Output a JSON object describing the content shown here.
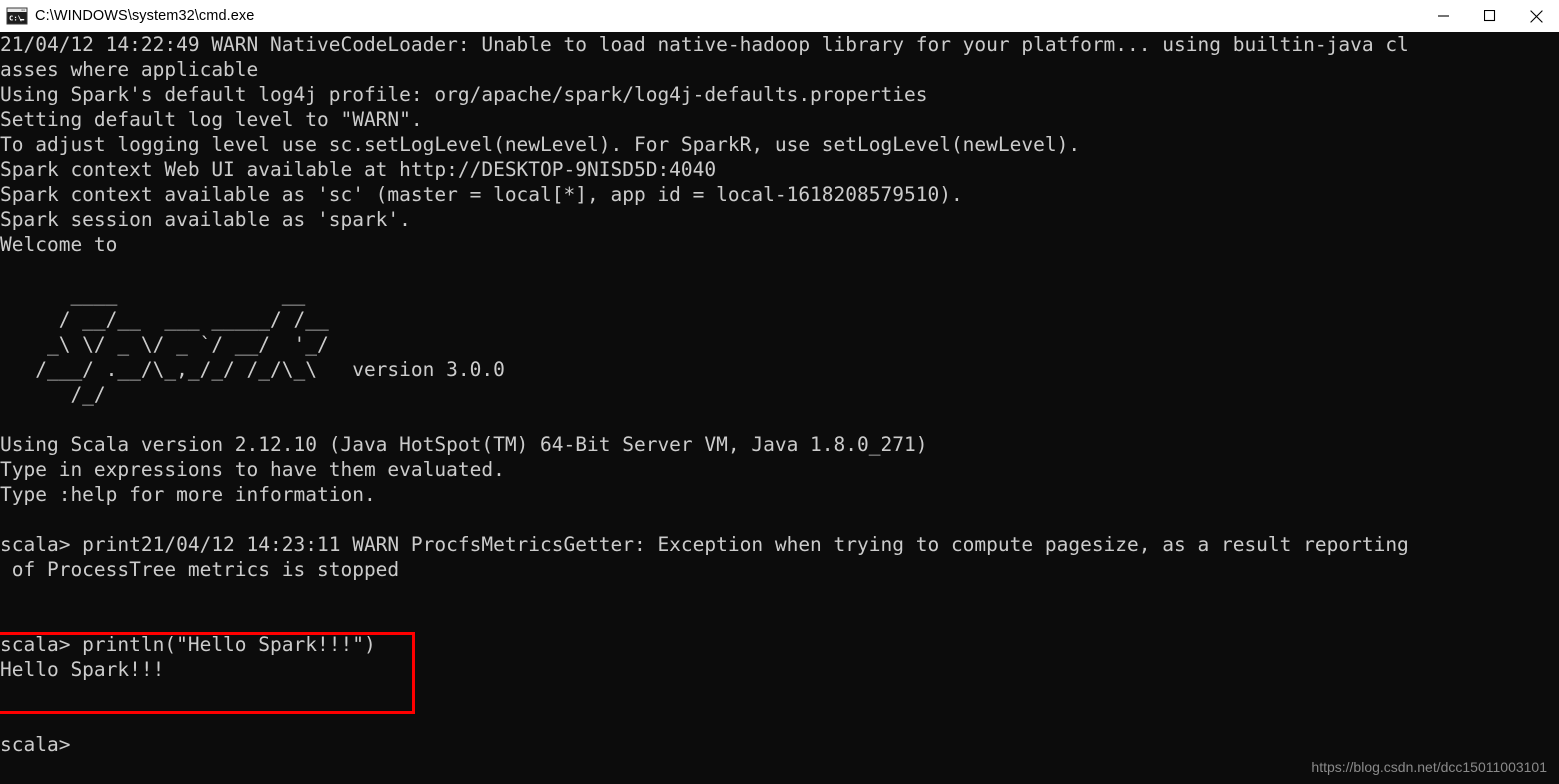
{
  "window": {
    "title": "C:\\WINDOWS\\system32\\cmd.exe",
    "icon": "cmd-console-icon",
    "controls": {
      "minimize_label": "Minimize",
      "maximize_label": "Maximize",
      "close_label": "Close"
    }
  },
  "colors": {
    "terminal_background": "#0c0c0c",
    "terminal_text": "#cccccc",
    "titlebar_background": "#ffffff",
    "titlebar_text": "#000000",
    "highlight_box": "#ff0000",
    "watermark_text": "#8a8a8a"
  },
  "terminal": {
    "lines": [
      "21/04/12 14:22:49 WARN NativeCodeLoader: Unable to load native-hadoop library for your platform... using builtin-java cl",
      "asses where applicable",
      "Using Spark's default log4j profile: org/apache/spark/log4j-defaults.properties",
      "Setting default log level to \"WARN\".",
      "To adjust logging level use sc.setLogLevel(newLevel). For SparkR, use setLogLevel(newLevel).",
      "Spark context Web UI available at http://DESKTOP-9NISD5D:4040",
      "Spark context available as 'sc' (master = local[*], app id = local-1618208579510).",
      "Spark session available as 'spark'.",
      "Welcome to",
      "",
      "      ____              __",
      "     / __/__  ___ _____/ /__",
      "    _\\ \\/ _ \\/ _ `/ __/  '_/",
      "   /___/ .__/\\_,_/_/ /_/\\_\\   version 3.0.0",
      "      /_/",
      "",
      "Using Scala version 2.12.10 (Java HotSpot(TM) 64-Bit Server VM, Java 1.8.0_271)",
      "Type in expressions to have them evaluated.",
      "Type :help for more information.",
      "",
      "scala> print21/04/12 14:23:11 WARN ProcfsMetricsGetter: Exception when trying to compute pagesize, as a result reporting",
      " of ProcessTree metrics is stopped",
      "",
      "",
      "scala> println(\"Hello Spark!!!\")",
      "Hello Spark!!!",
      "",
      "",
      "scala>"
    ],
    "highlighted_command": "scala> println(\"Hello Spark!!!\")",
    "highlighted_output": "Hello Spark!!!",
    "spark_version": "3.0.0",
    "scala_version": "2.12.10",
    "java_version": "1.8.0_271",
    "app_id": "local-1618208579510",
    "web_ui_url": "http://DESKTOP-9NISD5D:4040"
  },
  "watermark": {
    "text": "https://blog.csdn.net/dcc15011003101"
  }
}
